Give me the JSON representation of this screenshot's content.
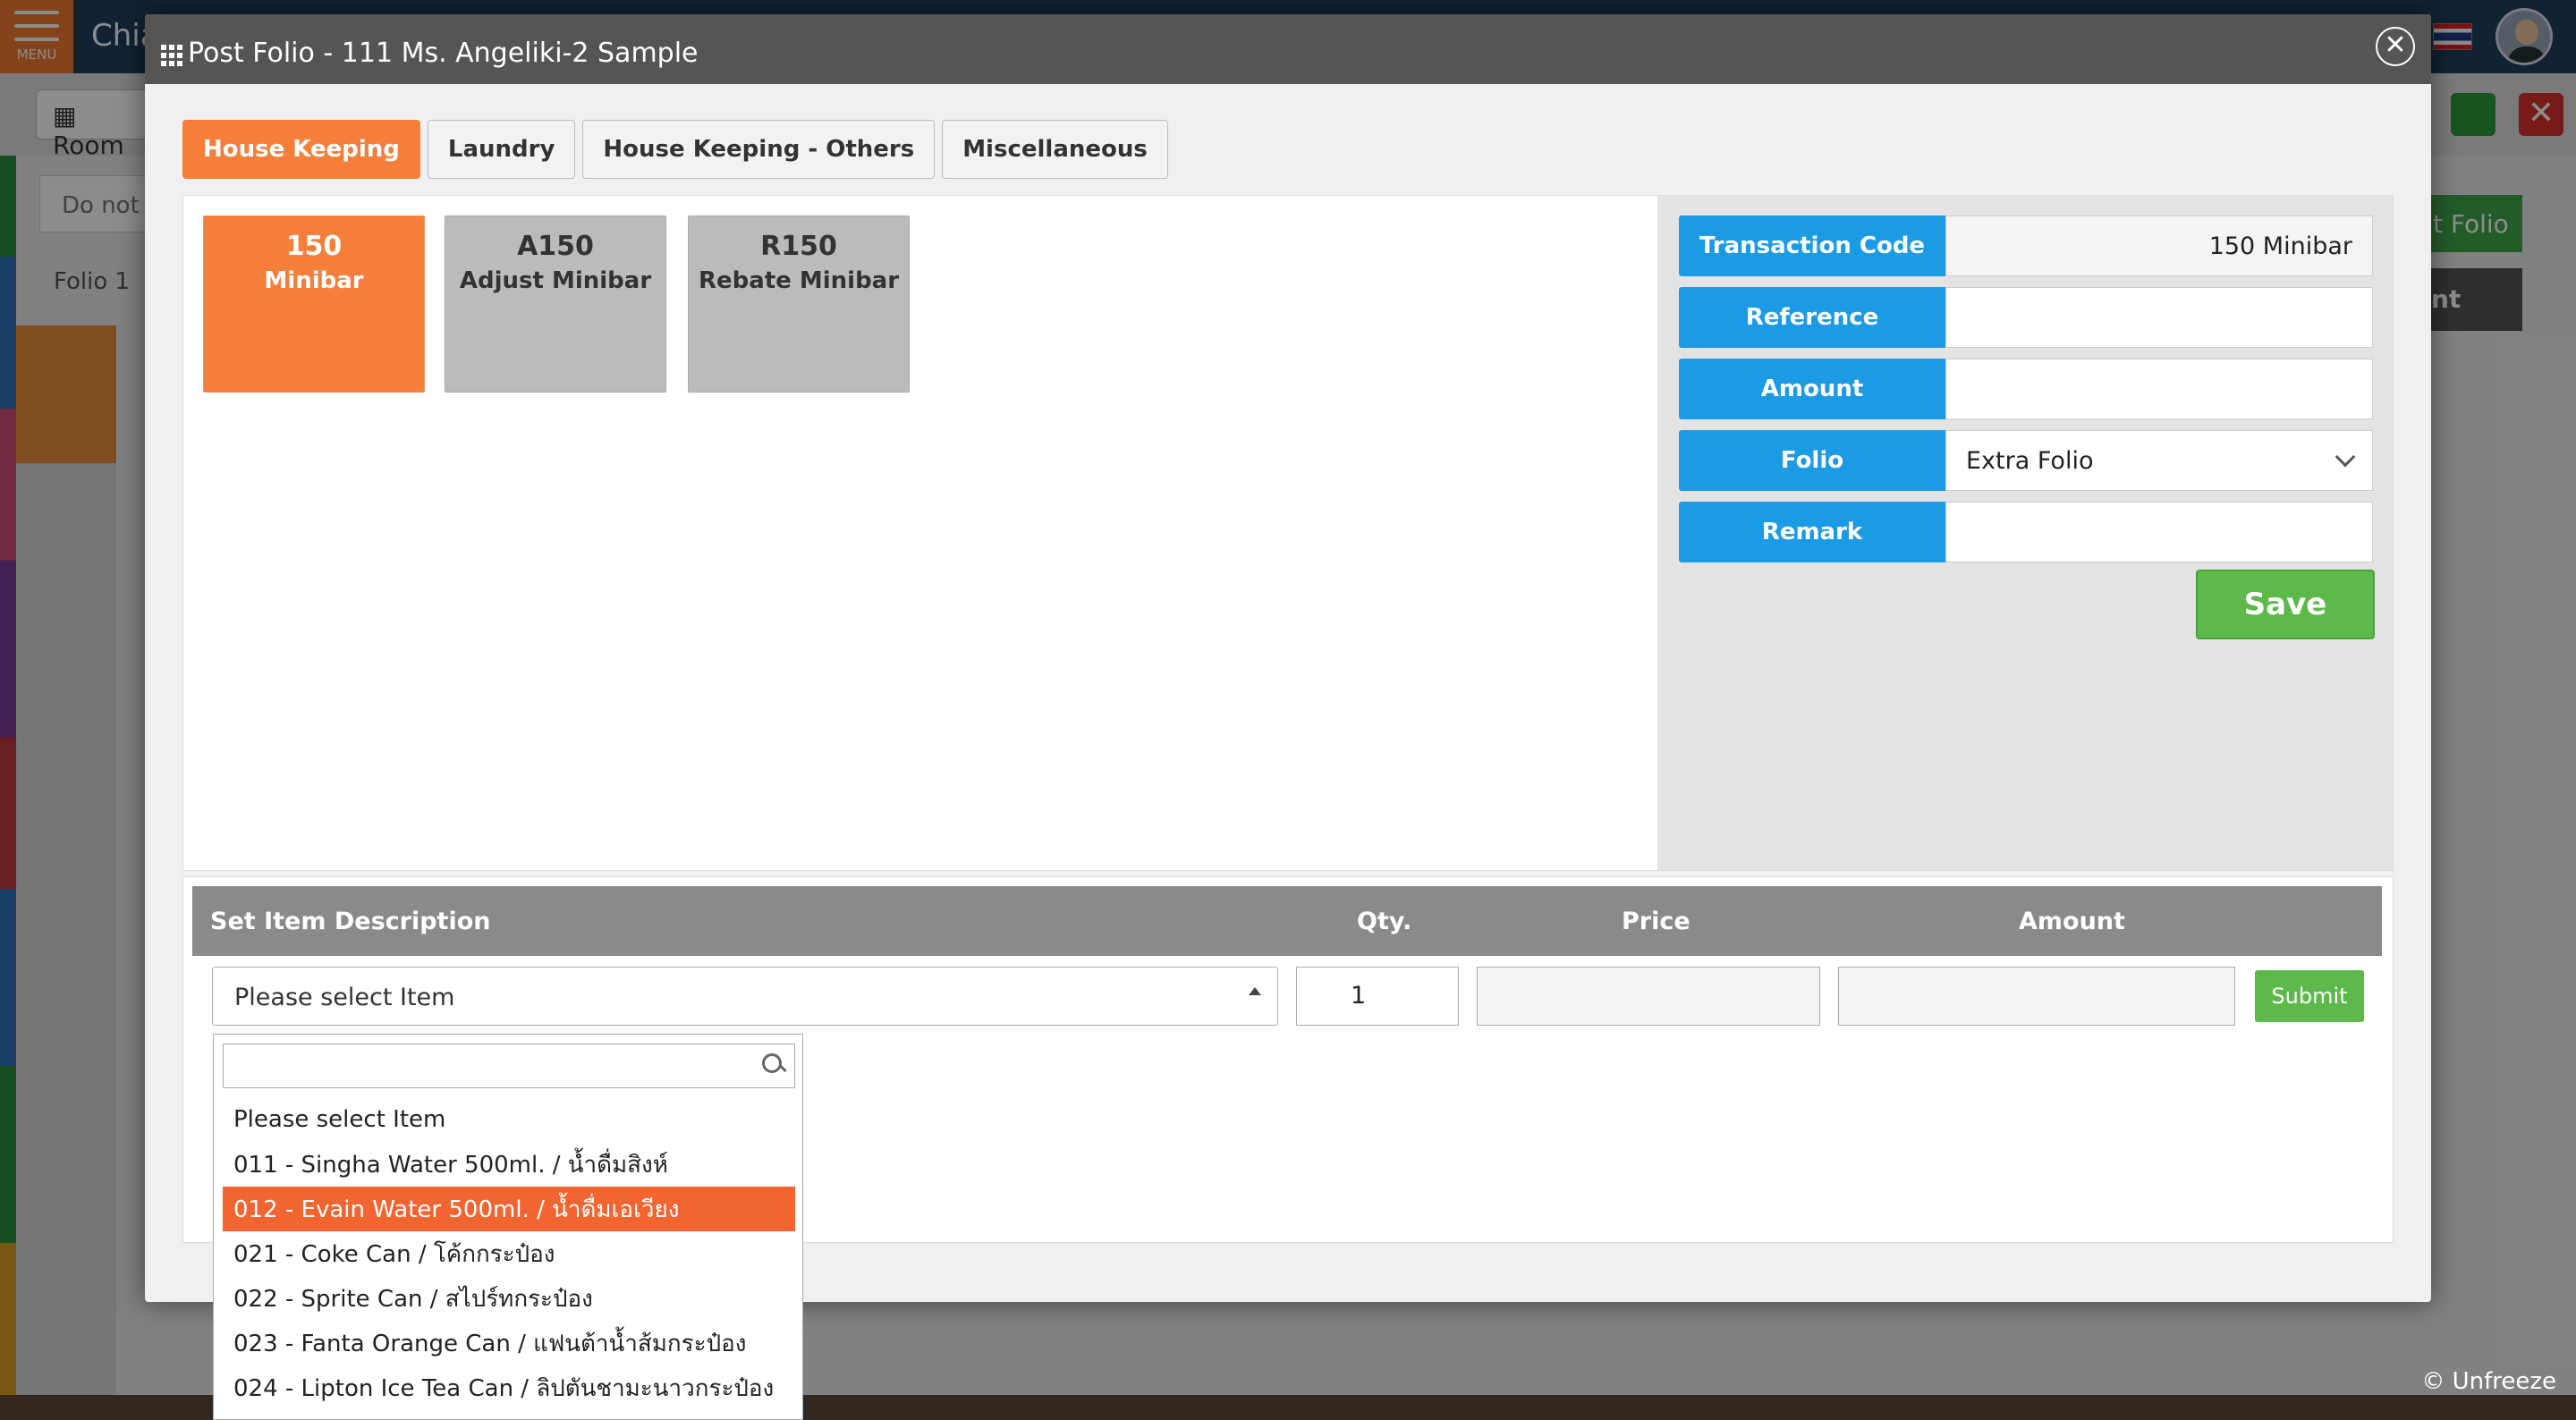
{
  "app": {
    "menu_label": "MENU",
    "title": "Chia",
    "rooms_button": "Room",
    "search_placeholder": "Do not s",
    "folio_label": "Folio 1",
    "right_btn1": "t Folio",
    "right_btn2": "nt",
    "unfreeze": "© Unfreeze",
    "close_symbol": "✕"
  },
  "modal": {
    "title": "Post Folio - 111 Ms. Angeliki-2 Sample",
    "close_symbol": "✕",
    "tabs": [
      {
        "label": "House Keeping",
        "active": true
      },
      {
        "label": "Laundry",
        "active": false
      },
      {
        "label": "House Keeping - Others",
        "active": false
      },
      {
        "label": "Miscellaneous",
        "active": false
      }
    ],
    "codes": [
      {
        "code": "150",
        "name": "Minibar",
        "active": true
      },
      {
        "code": "A150",
        "name": "Adjust Minibar",
        "active": false
      },
      {
        "code": "R150",
        "name": "Rebate Minibar",
        "active": false
      }
    ],
    "form": {
      "transaction_code_label": "Transaction Code",
      "transaction_code_value": "150 Minibar",
      "reference_label": "Reference",
      "reference_value": "",
      "amount_label": "Amount",
      "amount_value": "",
      "folio_label": "Folio",
      "folio_value": "Extra Folio",
      "remark_label": "Remark",
      "remark_value": ""
    },
    "save_label": "Save",
    "items": {
      "col_description": "Set Item Description",
      "col_qty": "Qty.",
      "col_price": "Price",
      "col_amount": "Amount",
      "select_value": "Please select Item",
      "qty_value": "1",
      "price_value": "",
      "amount_value": "",
      "submit_label": "Submit"
    },
    "dropdown": {
      "search_value": "",
      "options": [
        {
          "label": "Please select Item",
          "highlighted": false
        },
        {
          "label": "011 - Singha Water 500ml. / น้ำดื่มสิงห์",
          "highlighted": false
        },
        {
          "label": "012 - Evain Water 500ml. / น้ำดื่มเอเวียง",
          "highlighted": true
        },
        {
          "label": "021 - Coke Can / โค้กกระป๋อง",
          "highlighted": false
        },
        {
          "label": "022 - Sprite Can / สไปร์ทกระป๋อง",
          "highlighted": false
        },
        {
          "label": "023 - Fanta Orange Can / แฟนต้าน้ำส้มกระป๋อง",
          "highlighted": false
        },
        {
          "label": "024 - Lipton Ice Tea Can / ลิปตันชามะนาวกระป๋อง",
          "highlighted": false
        }
      ]
    }
  },
  "colors": {
    "accent_orange": "#f47e3a",
    "label_blue": "#1a9be3",
    "save_green": "#5cb94a",
    "highlight_red_orange": "#f26430"
  }
}
